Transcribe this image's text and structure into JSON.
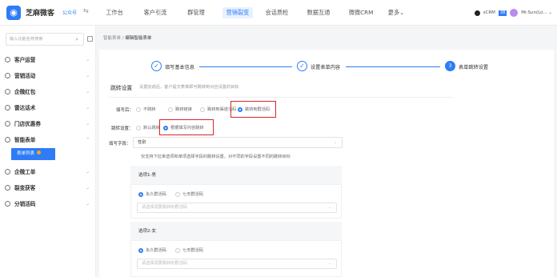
{
  "topbar": {
    "brand": "芝麻微客",
    "pub_tag": "公众号",
    "nav": [
      "工作台",
      "客户引流",
      "群管理",
      "营销裂变",
      "会话质检",
      "数据互通",
      "微微CRM",
      "更多⌄"
    ],
    "right_label": "sCRM",
    "user_label": "Mr.Sun(Lo... ⌄"
  },
  "sidebar": {
    "search_placeholder": "输入功能名称搜索",
    "items": [
      "客户运营",
      "营销活动",
      "企微红包",
      "雷达话术",
      "门店优惠券",
      "智能表单",
      "企微工单",
      "裂变获客",
      "分销活码"
    ],
    "active_sub": "表单列表"
  },
  "breadcrumb": {
    "parent": "智能表单",
    "sep": "/",
    "current": "编辑智能表单"
  },
  "steps": [
    {
      "label": "填写基本信息",
      "icon": "✓"
    },
    {
      "label": "设置表单内容",
      "icon": "✓"
    },
    {
      "label": "表单跳转设置",
      "icon": "3"
    }
  ],
  "section": {
    "title": "跳转设置",
    "desc": "设置完成后，客户提交表单即可跳转到对应设置的目标"
  },
  "after_fill": {
    "label": "填写后：",
    "options": [
      "不跳转",
      "跳转链接",
      "跳转到渠道活码",
      "跳转到群活码"
    ],
    "selected": 3
  },
  "jump_setting": {
    "label": "跳转设置：",
    "options": [
      "默认跳转",
      "根据填写内容跳转"
    ],
    "selected": 1
  },
  "fill_field": {
    "label": "填写字段：",
    "value": "性别"
  },
  "hint": "仅支持下拉单选项和单项选择字段的跳转设置，对不同的字段设置不同的跳转目标",
  "cards": [
    {
      "title": "选项1-男",
      "options": [
        "永久群活码",
        "七天群活码"
      ],
      "selected": 0,
      "select_placeholder": "请选择需要跳转的群活码"
    },
    {
      "title": "选项2-女",
      "options": [
        "永久群活码",
        "七天群活码"
      ],
      "selected": 0,
      "select_placeholder": "请选择需要跳转的群活码"
    }
  ],
  "colors": {
    "accent": "#2f7cf6",
    "highlight": "#d9262c"
  }
}
